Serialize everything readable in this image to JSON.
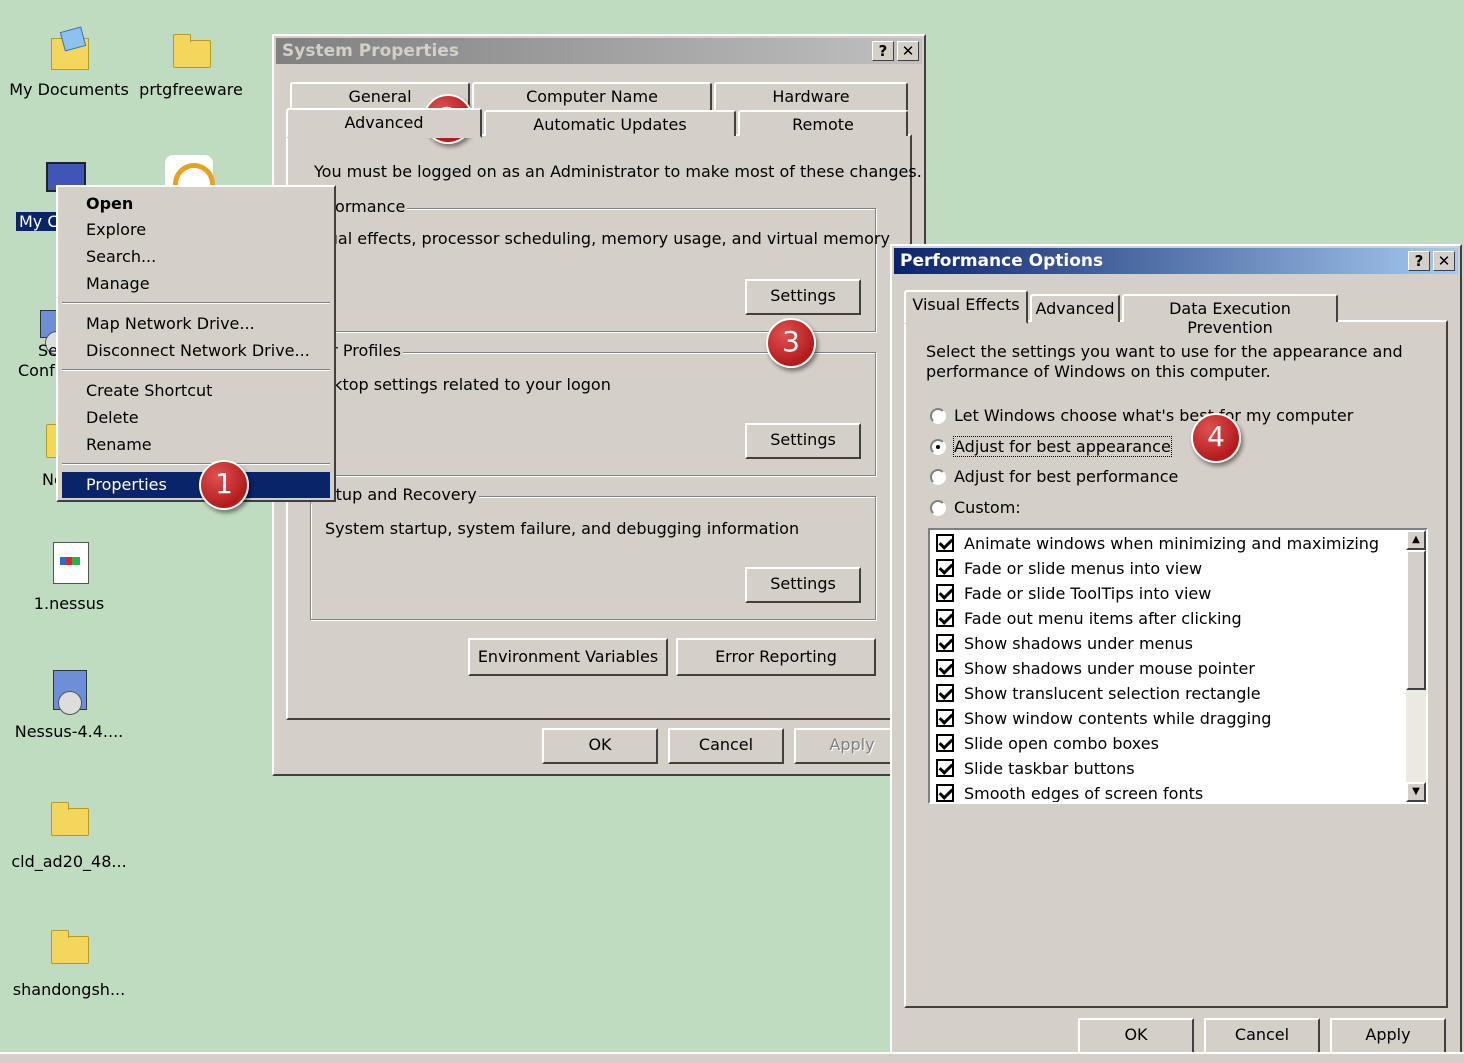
{
  "desktop": {
    "icons": [
      {
        "label": "My Documents",
        "icon": "my-documents-icon"
      },
      {
        "label": "prtgfreeware",
        "icon": "folder-icon"
      },
      {
        "label": "My C",
        "icon": "my-computer-icon"
      },
      {
        "label": "Se",
        "icon": "setup-icon"
      },
      {
        "label": "Conf",
        "icon": ""
      },
      {
        "label": "Ne",
        "icon": "folder-icon"
      },
      {
        "label": "1.nessus",
        "icon": "document-icon"
      },
      {
        "label": "Nessus-4.4....",
        "icon": "installer-icon"
      },
      {
        "label": "cld_ad20_48...",
        "icon": "folder-icon"
      },
      {
        "label": "shandongsh...",
        "icon": "folder-icon"
      }
    ]
  },
  "context_menu": {
    "items": [
      "Open",
      "Explore",
      "Search...",
      "Manage",
      "Map Network Drive...",
      "Disconnect Network Drive...",
      "Create Shortcut",
      "Delete",
      "Rename",
      "Properties"
    ],
    "selected": "Properties"
  },
  "system_properties": {
    "title": "System Properties",
    "help_btn": "?",
    "close_btn": "✕",
    "tabs_row1": [
      "General",
      "Computer Name",
      "Hardware"
    ],
    "tabs_row2": [
      "Advanced",
      "Automatic Updates",
      "Remote"
    ],
    "active_tab": "Advanced",
    "admin_note": "You must be logged on as an Administrator to make most of these changes.",
    "performance": {
      "title": "erformance",
      "desc": "isual effects, processor scheduling, memory usage, and virtual memory",
      "button": "Settings"
    },
    "user_profiles": {
      "title": "ser Profiles",
      "desc": "esktop settings related to your logon",
      "button": "Settings"
    },
    "startup": {
      "title": "tartup and Recovery",
      "desc": "System startup, system failure, and debugging information",
      "button": "Settings"
    },
    "env_button": "Environment Variables",
    "error_button": "Error Reporting",
    "ok": "OK",
    "cancel": "Cancel",
    "apply": "Apply"
  },
  "performance_options": {
    "title": "Performance Options",
    "help_btn": "?",
    "close_btn": "✕",
    "tabs": [
      "Visual Effects",
      "Advanced",
      "Data Execution Prevention"
    ],
    "active_tab": "Visual Effects",
    "intro_line1": "Select the settings you want to use for the appearance and",
    "intro_line2": "performance of Windows on this computer.",
    "radios": [
      {
        "label": "Let Windows choose what's best for my computer",
        "checked": false
      },
      {
        "label": "Adjust for best appearance",
        "checked": true
      },
      {
        "label": "Adjust for best performance",
        "checked": false
      },
      {
        "label": "Custom:",
        "checked": false
      }
    ],
    "effects": [
      "Animate windows when minimizing and maximizing",
      "Fade or slide menus into view",
      "Fade or slide ToolTips into view",
      "Fade out menu items after clicking",
      "Show shadows under menus",
      "Show shadows under mouse pointer",
      "Show translucent selection rectangle",
      "Show window contents while dragging",
      "Slide open combo boxes",
      "Slide taskbar buttons",
      "Smooth edges of screen fonts"
    ],
    "ok": "OK",
    "cancel": "Cancel",
    "apply": "Apply"
  },
  "badges": [
    "1",
    "2",
    "3",
    "4"
  ],
  "colors": {
    "desktop": "#c0dcc0",
    "selection": "#0a246a",
    "badge": "#b41c1c"
  }
}
